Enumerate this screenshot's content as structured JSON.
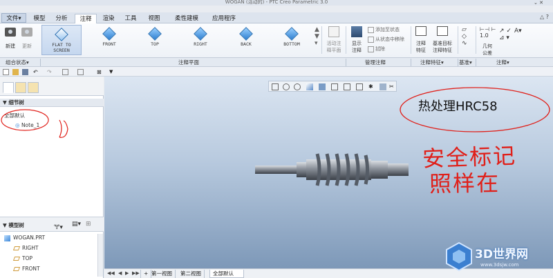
{
  "window": {
    "title": "WOGAN (活动的) - PTC Creo Parametric 3.0",
    "controls": "⌄ ✕"
  },
  "menu": {
    "file": "文件▾",
    "tabs": [
      "模型",
      "分析",
      "注释",
      "渲染",
      "工具",
      "视图",
      "柔性建模",
      "应用程序"
    ],
    "active_tab": "注释"
  },
  "ribbon": {
    "new_label": "新建",
    "update_label": "更新",
    "flat_label_1": "FLAT TO",
    "flat_label_2": "SCREEN",
    "views": [
      "FRONT",
      "TOP",
      "RIGHT",
      "BACK",
      "BOTTOM"
    ],
    "activate_label_1": "活动注",
    "activate_label_2": "释平面",
    "show_label_1": "显示",
    "show_label_2": "注释",
    "add_to_state": "添加至状态",
    "remove_from_state": "从状态中移除",
    "erase": "拭除",
    "annot_feature_1": "注释",
    "annot_feature_2": "特征",
    "datum_target_1": "基准目标",
    "datum_target_2": "注释特征",
    "geom_tol_1": "几何",
    "geom_tol_2": "公差"
  },
  "groups": [
    "组合状态▾",
    "注释平面",
    "管理注释",
    "注释特征▾",
    "基准▾",
    "注释▾"
  ],
  "detail_tree": {
    "header": "细节树",
    "root": "全部默认",
    "note": "Note_1"
  },
  "model_tree": {
    "header": "模型树",
    "items": [
      "WOGAN.PRT",
      "RIGHT",
      "TOP",
      "FRONT"
    ]
  },
  "annotation": {
    "title_note": "热处理HRC58",
    "handwriting_line1": "安全标记",
    "handwriting_line2": "照样在"
  },
  "bottom_tabs": [
    "第一视图",
    "第二视图",
    "全部默认"
  ],
  "active_bottom_tab": "全部默认",
  "watermark": {
    "name": "3D世界网",
    "url": "www.3dsjw.com"
  },
  "colors": {
    "accent": "#2f7fd6",
    "red_ink": "#e0201a",
    "viewport_top": "#dce6f2",
    "viewport_bottom": "#7d98b8"
  }
}
